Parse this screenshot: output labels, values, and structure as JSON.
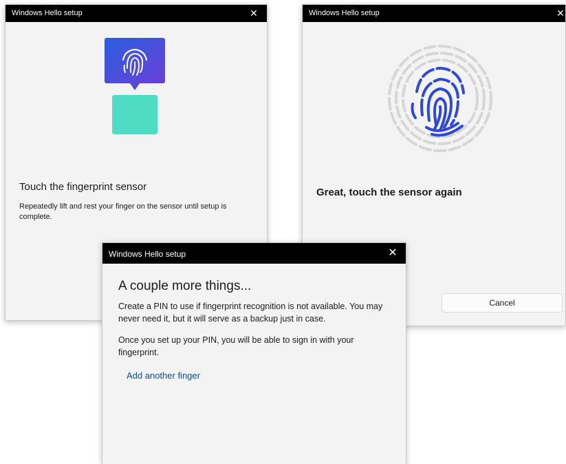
{
  "window_title": "Windows Hello setup",
  "close_glyph": "✕",
  "dialog_left": {
    "heading": "Touch the fingerprint sensor",
    "description": "Repeatedly lift and rest your finger on the sensor until setup is complete.",
    "icons": [
      "fingerprint-icon",
      "sensor-icon"
    ],
    "colors": {
      "bubble_top": "#2b5fe0",
      "bubble_bottom": "#6a3fd8",
      "sensor": "#4fdcc4"
    }
  },
  "dialog_right": {
    "heading": "Great, touch the sensor again",
    "cancel_label": "Cancel",
    "icons": [
      "fingerprint-progress-icon"
    ],
    "colors": {
      "progress": "#2f48d8",
      "remaining": "#d6d6d6"
    }
  },
  "dialog_front": {
    "heading": "A couple more things...",
    "paragraph1": "Create a PIN to use if fingerprint recognition is not available. You may never need it, but it will serve as a backup just in case.",
    "paragraph2": "Once you set up your PIN, you will be able to sign in with your fingerprint.",
    "link_label": "Add another finger"
  }
}
